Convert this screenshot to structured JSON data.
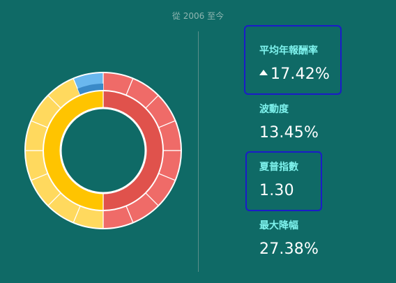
{
  "header": {
    "period": "從 2006 至今"
  },
  "stats": [
    {
      "label": "平均年報酬率",
      "value": "17.42%",
      "trend": "up"
    },
    {
      "label": "波動度",
      "value": "13.45%"
    },
    {
      "label": "夏普指數",
      "value": "1.30"
    },
    {
      "label": "最大降幅",
      "value": "27.38%"
    }
  ],
  "chart_data": {
    "type": "donut",
    "inner_ring": [
      {
        "value": 50,
        "color": "#e0524c"
      },
      {
        "value": 50,
        "color": "#ffc400"
      }
    ],
    "outer_ring": [
      {
        "value": 6.25,
        "color": "#ef6b68"
      },
      {
        "value": 6.25,
        "color": "#ef6b68"
      },
      {
        "value": 6.25,
        "color": "#ef6b68"
      },
      {
        "value": 6.25,
        "color": "#ef6b68"
      },
      {
        "value": 6.25,
        "color": "#ef6b68"
      },
      {
        "value": 6.25,
        "color": "#ef6b68"
      },
      {
        "value": 6.25,
        "color": "#ef6b68"
      },
      {
        "value": 6.25,
        "color": "#ef6b68"
      },
      {
        "value": 6.25,
        "color": "#ffd95e"
      },
      {
        "value": 6.25,
        "color": "#ffd95e"
      },
      {
        "value": 6.25,
        "color": "#ffd95e"
      },
      {
        "value": 6.25,
        "color": "#ffd95e"
      },
      {
        "value": 6.25,
        "color": "#ffd95e"
      },
      {
        "value": 6.25,
        "color": "#ffd95e"
      },
      {
        "value": 6.25,
        "color": "#ffd95e"
      },
      {
        "value": 6.25,
        "color": "#6ab8ef"
      }
    ],
    "accent_color": "#3a8ac8"
  }
}
